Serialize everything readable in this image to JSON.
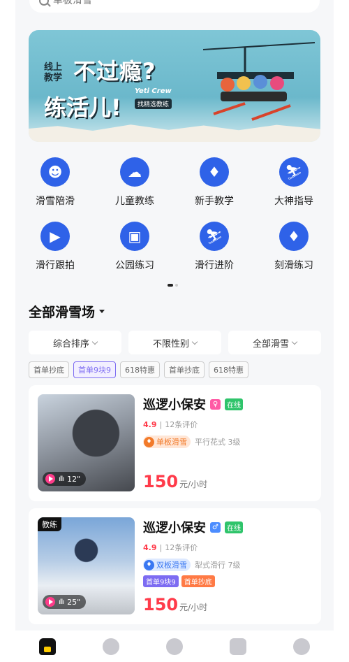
{
  "search": {
    "placeholder": "单板滑雪"
  },
  "banner": {
    "small_label": "线上教学",
    "headline": "不过瘾?",
    "subline": "练活儿!",
    "crew": "Yeti Crew",
    "coach_tag": "找精选教练"
  },
  "categories": [
    {
      "label": "滑雪陪滑",
      "icon": "avatar-icon"
    },
    {
      "label": "儿童教练",
      "icon": "child-icon"
    },
    {
      "label": "新手教学",
      "icon": "beginner-icon"
    },
    {
      "label": "大神指导",
      "icon": "expert-skier-icon"
    },
    {
      "label": "滑行跟拍",
      "icon": "camera-icon"
    },
    {
      "label": "公园练习",
      "icon": "park-icon"
    },
    {
      "label": "滑行进阶",
      "icon": "advanced-skier-icon"
    },
    {
      "label": "刻滑练习",
      "icon": "carving-icon"
    }
  ],
  "section": {
    "title": "全部滑雪场"
  },
  "filters": [
    "综合排序",
    "不限性别",
    "全部滑雪"
  ],
  "tags": [
    "首单抄底",
    "首单9块9",
    "618特惠",
    "首单抄底",
    "618特惠"
  ],
  "cards": [
    {
      "name": "巡逻小保安",
      "gender": "♀",
      "online": "在线",
      "score": "4.9",
      "reviews": "12条评价",
      "skill": "单板滑雪",
      "skill_detail": "平行花式 3级",
      "video": "12\"",
      "price": "150",
      "unit": "元/小时"
    },
    {
      "badge": "教练",
      "name": "巡逻小保安",
      "gender": "♂",
      "online": "在线",
      "score": "4.9",
      "reviews": "12条评价",
      "skill": "双板滑雪",
      "skill_detail": "犁式滑行 7级",
      "promos": [
        "首单9块9",
        "首单抄底"
      ],
      "video": "25\"",
      "price": "150",
      "unit": "元/小时"
    }
  ],
  "colors": {
    "accent": "#2f62e8",
    "price": "#ff3b4a",
    "promo": "#7d6cf2"
  }
}
